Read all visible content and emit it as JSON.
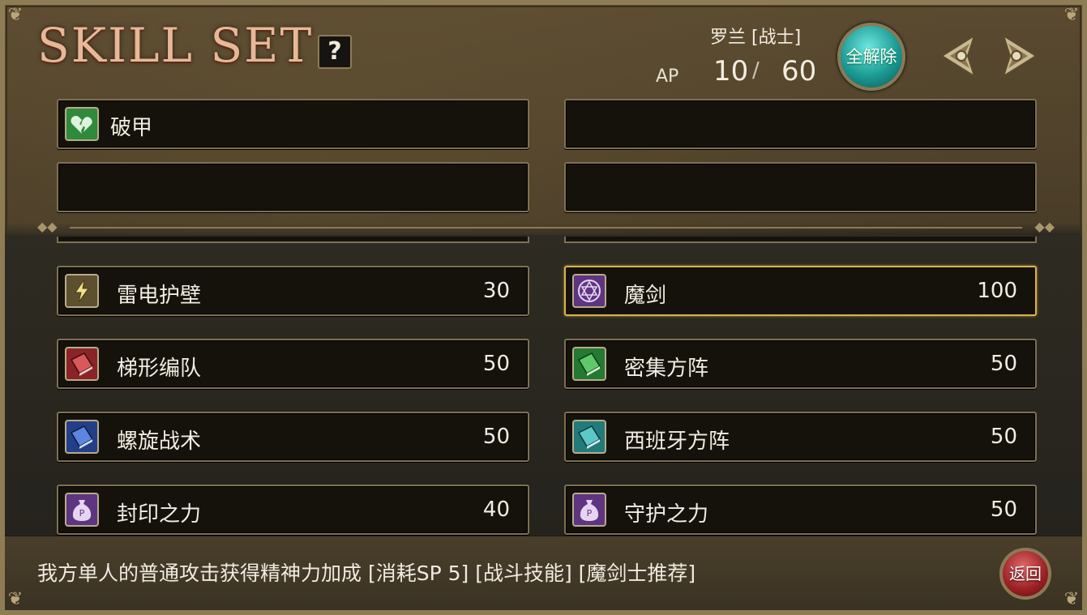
{
  "header": {
    "title": "SKILL SET",
    "help_label": "?",
    "character_name": "罗兰 [战士]",
    "ap_label": "AP",
    "ap_current": "10",
    "ap_slash": "/",
    "ap_max": "60",
    "clear_all_label": "全解除"
  },
  "equipped": [
    {
      "name": "破甲",
      "icon": "heart-crack-icon",
      "color": "#2f8a3a"
    },
    {
      "name": ""
    },
    {
      "name": ""
    },
    {
      "name": ""
    }
  ],
  "skills": [
    {
      "name": "雷电护壁",
      "cost": "30",
      "icon": "lightning-icon",
      "color": "#6b5a2a"
    },
    {
      "name": "魔剑",
      "cost": "100",
      "icon": "hexagram-icon",
      "color": "#6a3a8a",
      "selected": true
    },
    {
      "name": "梯形编队",
      "cost": "50",
      "icon": "red-book-icon",
      "color": "#9a2a2a"
    },
    {
      "name": "密集方阵",
      "cost": "50",
      "icon": "green-book-icon",
      "color": "#2f8a3a"
    },
    {
      "name": "螺旋战术",
      "cost": "50",
      "icon": "blue-book-icon",
      "color": "#2a4a9a"
    },
    {
      "name": "西班牙方阵",
      "cost": "50",
      "icon": "teal-book-icon",
      "color": "#2a8a8a"
    },
    {
      "name": "封印之力",
      "cost": "40",
      "icon": "money-bag-icon",
      "color": "#6a3a8a"
    },
    {
      "name": "守护之力",
      "cost": "50",
      "icon": "money-bag-icon",
      "color": "#6a3a8a"
    }
  ],
  "footer": {
    "description": "我方单人的普通攻击获得精神力加成 [消耗SP 5] [战斗技能] [魔剑士推荐]",
    "back_label": "返回"
  }
}
